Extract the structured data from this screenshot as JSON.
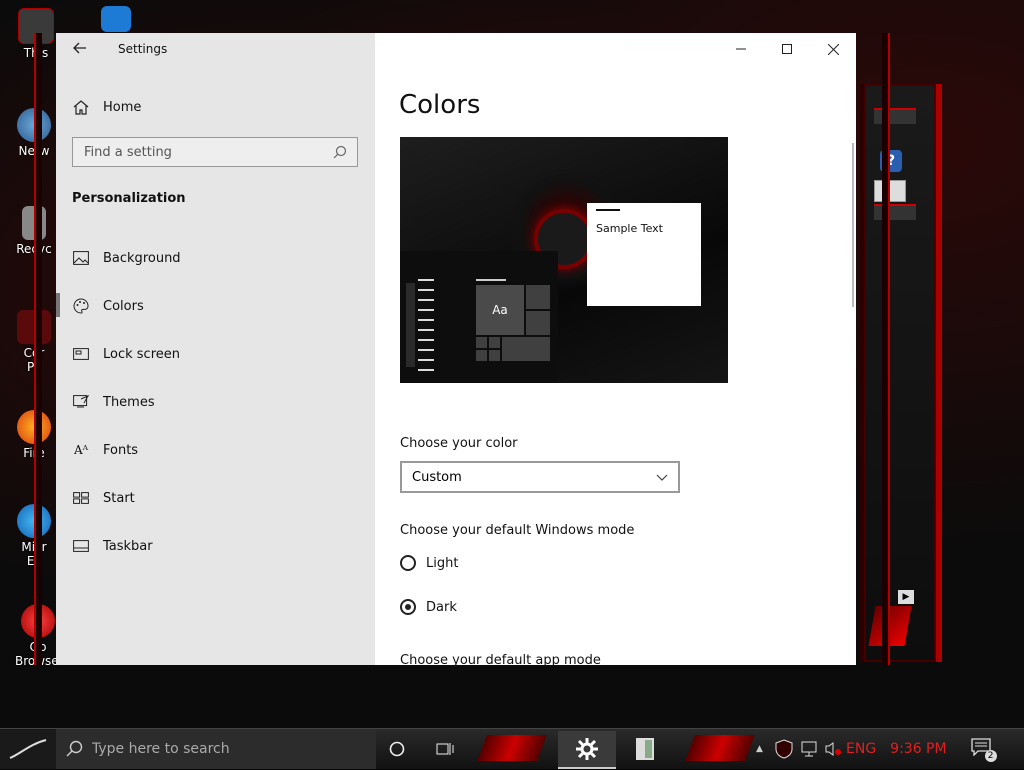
{
  "desktop": {
    "icons": [
      {
        "label": "This",
        "color": "#3a3a3a"
      },
      {
        "label": "Netw",
        "color": "#2d6a9f"
      },
      {
        "label": "Recyc",
        "color": "#777777"
      },
      {
        "label": "Cor Pa",
        "color": "#8a1010"
      },
      {
        "label": "Fire",
        "color": "#e46a10"
      },
      {
        "label": "Micr Ec",
        "color": "#1677c9"
      },
      {
        "label": "Op Browser",
        "color": "#d01818"
      }
    ]
  },
  "window": {
    "title": "Settings",
    "back_icon": "back-arrow-icon"
  },
  "sidebar": {
    "home_label": "Home",
    "search_placeholder": "Find a setting",
    "section_title": "Personalization",
    "items": [
      {
        "label": "Background",
        "icon": "image-icon"
      },
      {
        "label": "Colors",
        "icon": "palette-icon",
        "selected": true
      },
      {
        "label": "Lock screen",
        "icon": "lock-screen-icon"
      },
      {
        "label": "Themes",
        "icon": "themes-icon"
      },
      {
        "label": "Fonts",
        "icon": "fonts-icon"
      },
      {
        "label": "Start",
        "icon": "start-icon"
      },
      {
        "label": "Taskbar",
        "icon": "taskbar-icon"
      }
    ]
  },
  "content": {
    "title": "Colors",
    "preview": {
      "sample_text": "Sample Text",
      "tile_text": "Aa"
    },
    "choose_color_label": "Choose your color",
    "color_select_value": "Custom",
    "windows_mode_label": "Choose your default Windows mode",
    "windows_mode_options": [
      {
        "label": "Light",
        "checked": false
      },
      {
        "label": "Dark",
        "checked": true
      }
    ],
    "app_mode_label": "Choose your default app mode"
  },
  "taskbar": {
    "search_placeholder": "Type here to search",
    "language": "ENG",
    "time": "9:36 PM",
    "notification_count": "2"
  },
  "colors": {
    "accent_red": "#e02020",
    "sidebar_bg": "#e6e6e6"
  }
}
